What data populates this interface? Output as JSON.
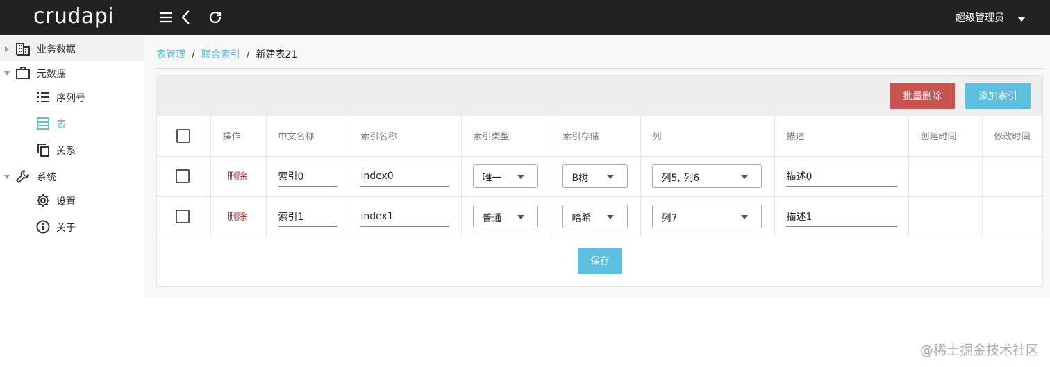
{
  "app": {
    "brand": "crudapi",
    "user": "超级管理员"
  },
  "sidebar": {
    "items": [
      {
        "label": "业务数据",
        "icon": "building-icon",
        "expandable": "collapsed"
      },
      {
        "label": "元数据",
        "icon": "briefcase-icon",
        "expandable": "expanded"
      },
      {
        "label": "序列号",
        "icon": "list-icon"
      },
      {
        "label": "表",
        "icon": "table-icon",
        "active": true
      },
      {
        "label": "关系",
        "icon": "copy-icon"
      },
      {
        "label": "系统",
        "icon": "wrench-icon",
        "expandable": "expanded"
      },
      {
        "label": "设置",
        "icon": "gear-icon"
      },
      {
        "label": "关于",
        "icon": "info-icon"
      }
    ]
  },
  "breadcrumb": {
    "item1": "表管理",
    "item2": "联合索引",
    "current": "新建表21",
    "sep": "/"
  },
  "toolbar": {
    "batch_delete": "批量删除",
    "add_index": "添加索引"
  },
  "table": {
    "headers": [
      "操作",
      "中文名称",
      "索引名称",
      "索引类型",
      "索引存储",
      "列",
      "描述",
      "创建时间",
      "修改时间"
    ],
    "rows": [
      {
        "action": "删除",
        "caption": "索引0",
        "name": "index0",
        "type": "唯一",
        "storage": "B树",
        "columns": "列5, 列6",
        "description": "描述0",
        "created": "",
        "modified": ""
      },
      {
        "action": "删除",
        "caption": "索引1",
        "name": "index1",
        "type": "普通",
        "storage": "哈希",
        "columns": "列7",
        "description": "描述1",
        "created": "",
        "modified": ""
      }
    ]
  },
  "save_label": "保存",
  "watermark": "@稀土掘金技术社区",
  "colors": {
    "topbar": "#222222",
    "accent": "#5bc0de",
    "danger": "#c9534f",
    "delete_link": "#b52a2a"
  }
}
